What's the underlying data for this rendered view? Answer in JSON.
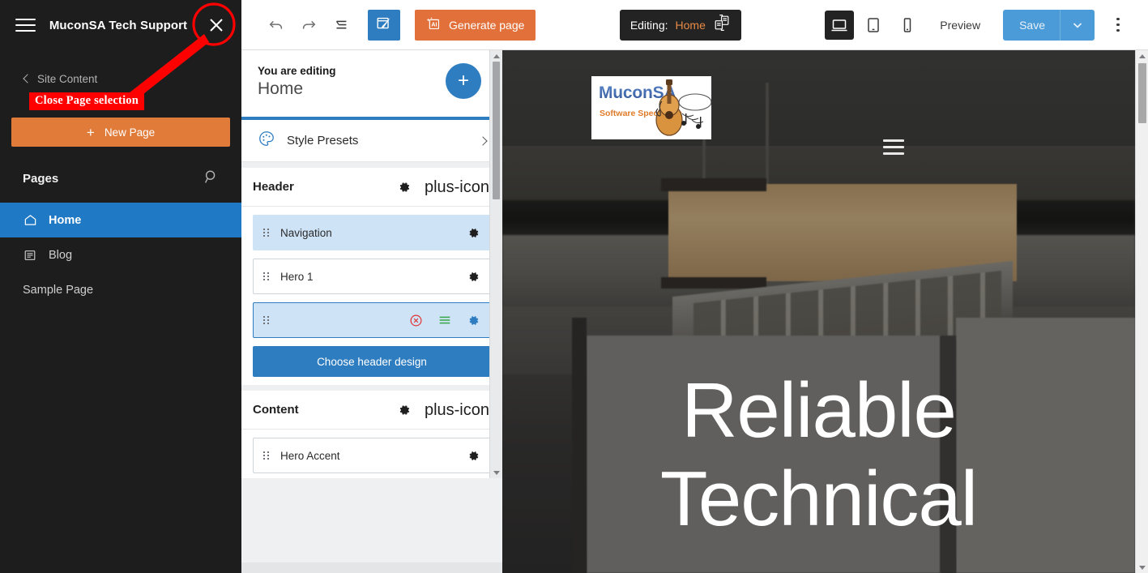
{
  "sidebar": {
    "menu_icon": "hamburger-icon",
    "title": "MuconSA Tech Support",
    "close_icon": "close-icon",
    "breadcrumb": "Site Content",
    "new_page_button": "New Page",
    "new_page_plus": "+",
    "pages_heading": "Pages",
    "search_icon": "search-icon",
    "pages": [
      {
        "label": "Home",
        "icon": "home-icon",
        "active": true
      },
      {
        "label": "Blog",
        "icon": "blog-icon",
        "active": false
      },
      {
        "label": "Sample Page",
        "icon": "none",
        "active": false
      }
    ]
  },
  "annotation": {
    "label": "Close Page selection",
    "color": "#ff0000",
    "target_icon": "close-icon"
  },
  "toolbar": {
    "undo_icon": "undo-icon",
    "redo_icon": "redo-icon",
    "outline_icon": "outline-list-icon",
    "edit_button_icon": "window-pencil-icon",
    "generate_label": "Generate page",
    "generate_icon": "ai-badge-icon",
    "editing_key": "Editing:",
    "editing_value": "Home",
    "editing_switch_icon": "switch-page-icon",
    "devices": [
      {
        "name": "desktop-icon",
        "active": true
      },
      {
        "name": "tablet-icon",
        "active": false
      },
      {
        "name": "mobile-icon",
        "active": false
      }
    ],
    "preview_label": "Preview",
    "save_label": "Save",
    "save_caret_icon": "chevron-down-icon",
    "kebab_icon": "more-vertical-icon"
  },
  "edit_panel": {
    "eyebrow": "You are editing",
    "page_name": "Home",
    "add_button": "+",
    "style_presets_label": "Style Presets",
    "style_presets_icon": "palette-icon",
    "chevron_icon": "chevron-right-icon",
    "sections": [
      {
        "title": "Header",
        "gear_icon": "gear-icon",
        "plus_icon": "plus-icon",
        "blocks": [
          {
            "name": "Navigation",
            "state": "selected",
            "gear_icon": "gear-icon",
            "grip_icon": "drag-grip-icon"
          },
          {
            "name": "Hero 1",
            "state": "default",
            "gear_icon": "gear-icon",
            "grip_icon": "drag-grip-icon"
          },
          {
            "name": "",
            "state": "active",
            "grip_icon": "drag-grip-icon",
            "remove_icon": "remove-circle-icon",
            "lines_icon": "menu-lines-icon",
            "gear_icon": "gear-icon"
          }
        ],
        "cta": "Choose header design"
      },
      {
        "title": "Content",
        "gear_icon": "gear-icon",
        "plus_icon": "plus-icon",
        "blocks": [
          {
            "name": "Hero Accent",
            "state": "default",
            "gear_icon": "gear-icon",
            "grip_icon": "drag-grip-icon"
          },
          {
            "name": "",
            "state": "default",
            "gear_icon": "gear-icon",
            "grip_icon": "drag-grip-icon"
          }
        ]
      }
    ]
  },
  "preview": {
    "logo_brand": "MuconSA",
    "logo_tagline": "Software Specialists",
    "logo_art_icon": "guitar-music-notes-icon",
    "nav_menu_icon": "hamburger-icon",
    "hero_line_1": "Reliable",
    "hero_line_2": "Technical",
    "scrollbar_icon": "vertical-scrollbar"
  },
  "colors": {
    "sidebar_bg": "#1d1d1d",
    "accent_blue": "#2e7dc0",
    "accent_orange": "#e07b39",
    "annotation_red": "#ff0000",
    "selected_row": "#cfe3f7",
    "save_blue": "#4a9bd8"
  }
}
